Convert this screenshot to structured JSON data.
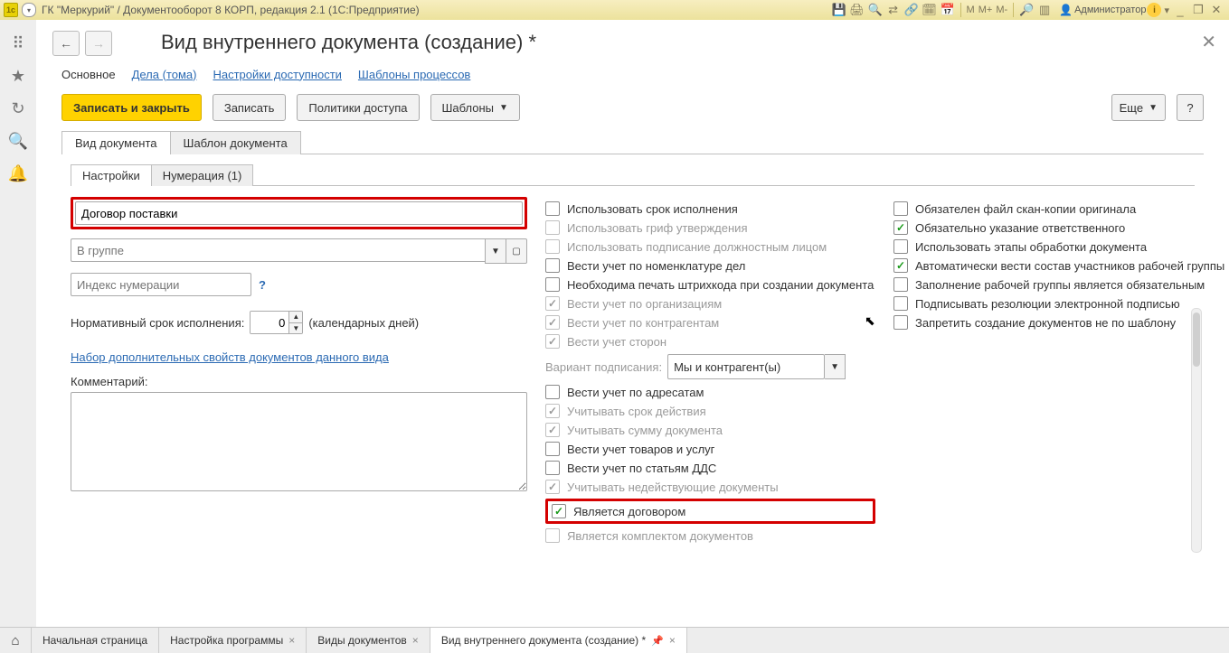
{
  "titlebar": {
    "text": "ГК \"Меркурий\" / Документооборот 8 КОРП, редакция 2.1  (1С:Предприятие)",
    "user": "Администратор",
    "icons": {
      "save": "save-icon",
      "print": "print-icon",
      "preview": "preview-icon",
      "fav": "star-icon",
      "clip": "clip-icon",
      "calc": "calc-icon",
      "cal": "calendar-icon",
      "date": "date-icon",
      "m": "M",
      "mplus": "M+",
      "mminus": "M-",
      "zoom": "zoom-icon",
      "panes": "panes-icon",
      "info": "i",
      "min": "_",
      "rest": "❐",
      "close": "✕"
    }
  },
  "rail": {
    "apps": "∷",
    "star": "★",
    "history": "↻",
    "search": "🔍",
    "bell": "🔔"
  },
  "page": {
    "title": "Вид внутреннего документа (создание) *",
    "back": "←",
    "forward": "→",
    "close": "✕"
  },
  "sections": {
    "s1": "Основное",
    "s2": "Дела (тома)",
    "s3": "Настройки доступности",
    "s4": "Шаблоны процессов"
  },
  "toolbar": {
    "save_close": "Записать и закрыть",
    "save": "Записать",
    "policies": "Политики доступа",
    "templates": "Шаблоны",
    "more": "Еще",
    "help": "?"
  },
  "tabs1": {
    "t1": "Вид документа",
    "t2": "Шаблон документа"
  },
  "tabs2": {
    "t1": "Настройки",
    "t2": "Нумерация (1)"
  },
  "left": {
    "name_value": "Договор поставки",
    "group_placeholder": "В группе",
    "index_placeholder": "Индекс нумерации",
    "norm_label": "Нормативный срок исполнения:",
    "norm_value": "0",
    "norm_unit": "(календарных дней)",
    "extra_props": "Набор дополнительных свойств документов данного вида",
    "comment_label": "Комментарий:"
  },
  "mid": {
    "c1": "Использовать срок исполнения",
    "c2": "Использовать гриф утверждения",
    "c3": "Использовать подписание должностным лицом",
    "c4": "Вести учет по номенклатуре дел",
    "c5": "Необходима печать штрихкода при создании документа",
    "c6": "Вести учет по организациям",
    "c7": "Вести учет по контрагентам",
    "c8": "Вести учет сторон",
    "variant_label": "Вариант подписания:",
    "variant_value": "Мы и контрагент(ы)",
    "c9": "Вести учет по адресатам",
    "c10": "Учитывать срок действия",
    "c11": "Учитывать сумму документа",
    "c12": "Вести учет товаров и услуг",
    "c13": "Вести учет по статьям ДДС",
    "c14": "Учитывать недействующие документы",
    "c15": "Является договором",
    "c16": "Является комплектом документов"
  },
  "right": {
    "r1": "Обязателен файл скан-копии оригинала",
    "r2": "Обязательно указание ответственного",
    "r3": "Использовать этапы обработки документа",
    "r4": "Автоматически вести состав участников рабочей группы",
    "r5": "Заполнение рабочей группы является обязательным",
    "r6": "Подписывать резолюции электронной подписью",
    "r7": "Запретить создание документов не по шаблону"
  },
  "bottom": {
    "t1": "Начальная страница",
    "t2": "Настройка программы",
    "t3": "Виды документов",
    "t4": "Вид внутреннего документа (создание) *"
  }
}
